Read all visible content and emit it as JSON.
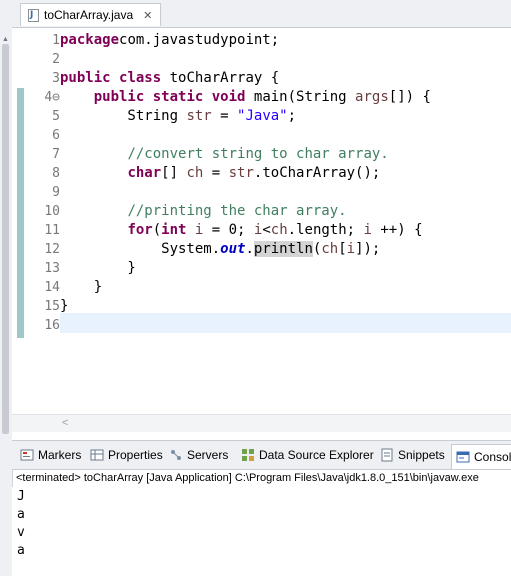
{
  "editor_tab": {
    "label": "toCharArray.java",
    "close_glyph": "✕"
  },
  "code_lines": [
    {
      "n": "1",
      "parts": [
        [
          "kw",
          "package"
        ],
        [
          "",
          "com.javastudypoint;"
        ]
      ]
    },
    {
      "n": "2",
      "parts": []
    },
    {
      "n": "3",
      "parts": [
        [
          "kw",
          "public"
        ],
        [
          "",
          " "
        ],
        [
          "kw",
          "class"
        ],
        [
          "",
          " toCharArray {"
        ]
      ]
    },
    {
      "n": "4⊖",
      "parts": [
        [
          "",
          "    "
        ],
        [
          "kw",
          "public"
        ],
        [
          "",
          " "
        ],
        [
          "kw",
          "static"
        ],
        [
          "",
          " "
        ],
        [
          "kw",
          "void"
        ],
        [
          "",
          " main(String "
        ],
        [
          "var",
          "args"
        ],
        [
          "",
          "[]) {"
        ]
      ]
    },
    {
      "n": "5",
      "parts": [
        [
          "",
          "        String "
        ],
        [
          "var",
          "str"
        ],
        [
          "",
          " = "
        ],
        [
          "str",
          "\"Java\""
        ],
        [
          "",
          ";"
        ]
      ]
    },
    {
      "n": "6",
      "parts": []
    },
    {
      "n": "7",
      "parts": [
        [
          "",
          "        "
        ],
        [
          "cmt",
          "//convert string to char array."
        ]
      ]
    },
    {
      "n": "8",
      "parts": [
        [
          "",
          "        "
        ],
        [
          "kw",
          "char"
        ],
        [
          "",
          "[] "
        ],
        [
          "var",
          "ch"
        ],
        [
          "",
          " = "
        ],
        [
          "var",
          "str"
        ],
        [
          "",
          ".toCharArray();"
        ]
      ]
    },
    {
      "n": "9",
      "parts": []
    },
    {
      "n": "10",
      "parts": [
        [
          "",
          "        "
        ],
        [
          "cmt",
          "//printing the char array."
        ]
      ]
    },
    {
      "n": "11",
      "parts": [
        [
          "",
          "        "
        ],
        [
          "kw",
          "for"
        ],
        [
          "",
          "("
        ],
        [
          "kw",
          "int"
        ],
        [
          "",
          " "
        ],
        [
          "var",
          "i"
        ],
        [
          "",
          " = 0; "
        ],
        [
          "var",
          "i"
        ],
        [
          "",
          "<"
        ],
        [
          "var",
          "ch"
        ],
        [
          "",
          ".length; "
        ],
        [
          "var",
          "i"
        ],
        [
          "",
          " ++) {"
        ]
      ]
    },
    {
      "n": "12",
      "parts": [
        [
          "",
          "            System."
        ],
        [
          "fld",
          "out"
        ],
        [
          "",
          "."
        ],
        [
          "occ",
          "println"
        ],
        [
          "",
          "("
        ],
        [
          "var",
          "ch"
        ],
        [
          "",
          "["
        ],
        [
          "var",
          "i"
        ],
        [
          "",
          "]);"
        ]
      ]
    },
    {
      "n": "13",
      "parts": [
        [
          "",
          "        }"
        ]
      ]
    },
    {
      "n": "14",
      "parts": [
        [
          "",
          "    }"
        ]
      ]
    },
    {
      "n": "15",
      "parts": [
        [
          "",
          "}"
        ]
      ]
    },
    {
      "n": "16",
      "parts": []
    }
  ],
  "views_tabs": [
    {
      "label": "Markers",
      "icon": "markers-icon"
    },
    {
      "label": "Properties",
      "icon": "properties-icon"
    },
    {
      "label": "Servers",
      "icon": "servers-icon"
    },
    {
      "label": "Data Source Explorer",
      "icon": "data-source-explorer-icon"
    },
    {
      "label": "Snippets",
      "icon": "snippets-icon"
    },
    {
      "label": "Console",
      "icon": "console-icon"
    }
  ],
  "console": {
    "header": "<terminated> toCharArray [Java Application] C:\\Program Files\\Java\\jdk1.8.0_151\\bin\\javaw.exe",
    "output": [
      "J",
      "a",
      "v",
      "a"
    ]
  },
  "colors": {
    "keyword": "#7f0055",
    "string": "#2a00ff",
    "comment": "#3f7f5f",
    "field": "#0000c0",
    "variable": "#6a3e3e",
    "current_line": "#e8f2fe",
    "change_bar": "#9ec9c6"
  }
}
